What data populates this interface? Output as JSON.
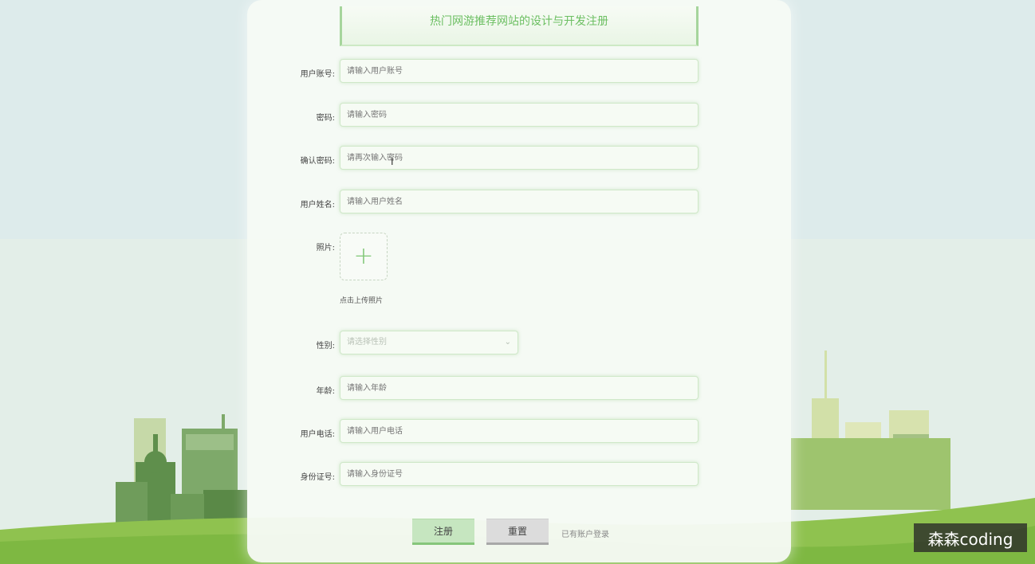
{
  "page": {
    "title": "热门网游推荐网站的设计与开发注册"
  },
  "form": {
    "account": {
      "label": "用户账号:",
      "placeholder": "请输入用户账号"
    },
    "password": {
      "label": "密码:",
      "placeholder": "请输入密码"
    },
    "confirm": {
      "label": "确认密码:",
      "placeholder": "请再次输入密码"
    },
    "name": {
      "label": "用户姓名:",
      "placeholder": "请输入用户姓名"
    },
    "photo": {
      "label": "照片:",
      "hint": "点击上传照片"
    },
    "gender": {
      "label": "性别:",
      "placeholder": "请选择性别"
    },
    "age": {
      "label": "年龄:",
      "placeholder": "请输入年龄"
    },
    "phone": {
      "label": "用户电话:",
      "placeholder": "请输入用户电话"
    },
    "idcard": {
      "label": "身份证号:",
      "placeholder": "请输入身份证号"
    }
  },
  "actions": {
    "register": "注册",
    "reset": "重置",
    "login_link": "已有账户登录"
  },
  "watermark": "森森coding",
  "icons": {
    "upload": "plus-icon",
    "select": "chevron-down-icon"
  },
  "colors": {
    "accent": "#6cbf62",
    "field_border": "#cfe8c8"
  }
}
